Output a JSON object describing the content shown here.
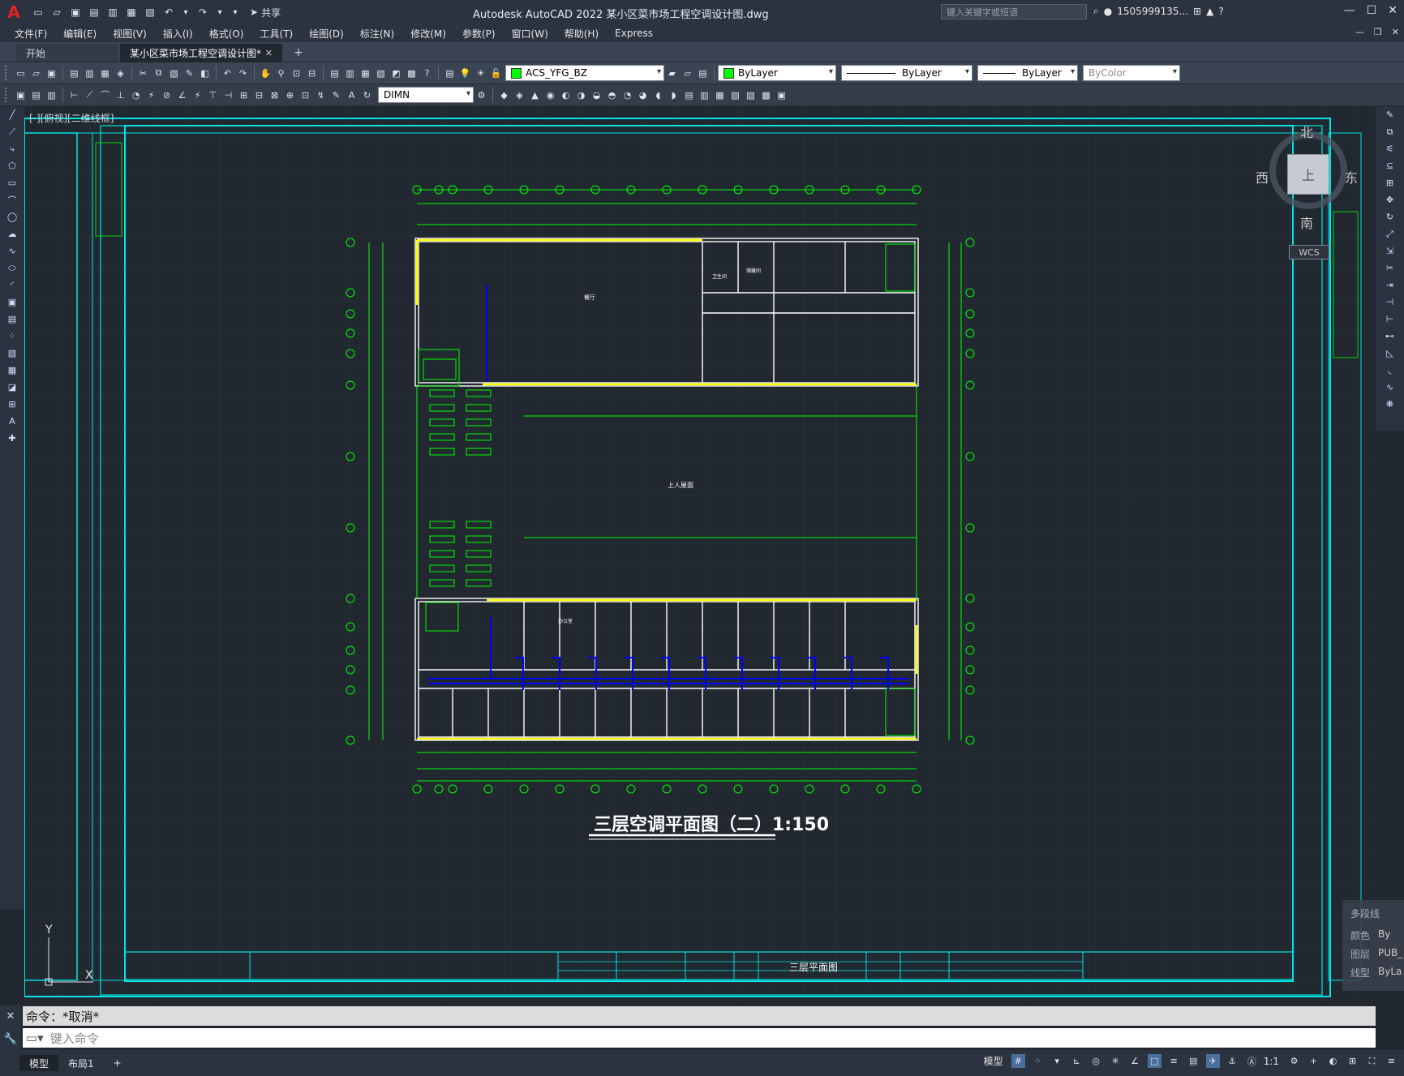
{
  "app": {
    "window_title": "Autodesk AutoCAD 2022    某小区菜市场工程空调设计图.dwg",
    "share_label": "共享",
    "search_placeholder": "键入关键字或短语",
    "user_name": "1505999135..."
  },
  "menu": [
    "文件(F)",
    "编辑(E)",
    "视图(V)",
    "插入(I)",
    "格式(O)",
    "工具(T)",
    "绘图(D)",
    "标注(N)",
    "修改(M)",
    "参数(P)",
    "窗口(W)",
    "帮助(H)",
    "Express"
  ],
  "file_tabs": {
    "start": "开始",
    "active": "某小区菜市场工程空调设计图*"
  },
  "toolbar": {
    "layer": "ACS_YFG_BZ",
    "color": "ByLayer",
    "linetype": "ByLayer",
    "lineweight": "ByLayer",
    "plotstyle": "ByColor",
    "dimstyle": "DIMN"
  },
  "viewport_label": "[-][俯视][二维线框]",
  "viewcube": {
    "north": "北",
    "south": "南",
    "west": "西",
    "east": "东",
    "top": "上",
    "wcs": "WCS"
  },
  "drawing": {
    "title": "三层空调平面图（二）1:150",
    "sheet_name": "三层平面图",
    "room_labels": {
      "hall": "餐厅",
      "upper_roof": "上人屋面",
      "office": "办公室",
      "toilet": "卫生间",
      "storage": "储藏间"
    }
  },
  "properties_panel": {
    "title": "多段线",
    "color_label": "颜色",
    "color_value": "By",
    "layer_label": "图层",
    "layer_value": "PUB_",
    "linetype_label": "线型",
    "linetype_value": "ByLa"
  },
  "command": {
    "history": "命令：*取消*",
    "placeholder": "键入命令"
  },
  "layouts": {
    "model": "模型",
    "layout1": "布局1"
  },
  "status": {
    "model_space": "模型",
    "scale": "1:1"
  },
  "colors": {
    "bg": "#212830",
    "frame": "#00e5e5",
    "wall": "#ffffff",
    "grid": "#00ff00",
    "duct": "#0000ff",
    "highlight": "#ffff00"
  }
}
